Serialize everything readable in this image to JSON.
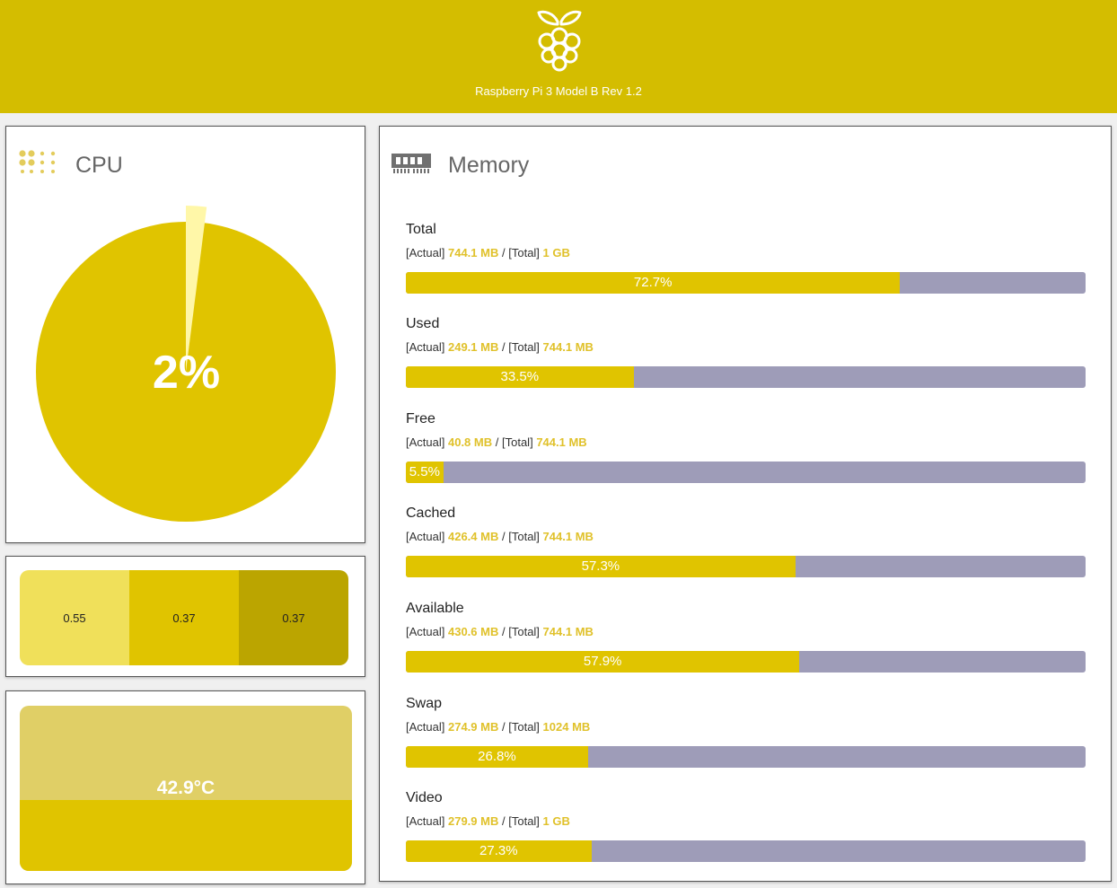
{
  "header": {
    "title": "Raspberry Pi 3 Model B Rev 1.2",
    "logo_icon": "raspberry-pi-logo-icon",
    "background": "#d4bd00"
  },
  "cpu": {
    "title": "CPU",
    "icon": "cpu-chip-icon",
    "usage_label": "2%",
    "usage_fraction": 0.02,
    "colors": {
      "used": "#fff7a8",
      "free": "#e0c400"
    }
  },
  "load": {
    "values": [
      "0.55",
      "0.37",
      "0.37"
    ],
    "colors": [
      "#f0e05a",
      "#e0c400",
      "#bba500"
    ]
  },
  "temperature": {
    "label": "42.9°C",
    "fill_fraction": 0.429,
    "colors": {
      "fill": "#e0c400",
      "empty": "#e0cf66"
    }
  },
  "memory": {
    "title": "Memory",
    "icon": "ram-module-icon",
    "items": [
      {
        "name": "Total",
        "actual_label": "[Actual]",
        "actual": "744.1 MB",
        "sep": "/",
        "total_label": "[Total]",
        "total": "1 GB",
        "percent": "72.7%",
        "fraction": 0.727
      },
      {
        "name": "Used",
        "actual_label": "[Actual]",
        "actual": "249.1 MB",
        "sep": "/",
        "total_label": "[Total]",
        "total": "744.1 MB",
        "percent": "33.5%",
        "fraction": 0.335
      },
      {
        "name": "Free",
        "actual_label": "[Actual]",
        "actual": "40.8 MB",
        "sep": "/",
        "total_label": "[Total]",
        "total": "744.1 MB",
        "percent": "5.5%",
        "fraction": 0.055
      },
      {
        "name": "Cached",
        "actual_label": "[Actual]",
        "actual": "426.4 MB",
        "sep": "/",
        "total_label": "[Total]",
        "total": "744.1 MB",
        "percent": "57.3%",
        "fraction": 0.573
      },
      {
        "name": "Available",
        "actual_label": "[Actual]",
        "actual": "430.6 MB",
        "sep": "/",
        "total_label": "[Total]",
        "total": "744.1 MB",
        "percent": "57.9%",
        "fraction": 0.579
      },
      {
        "name": "Swap",
        "actual_label": "[Actual]",
        "actual": "274.9 MB",
        "sep": "/",
        "total_label": "[Total]",
        "total": "1024 MB",
        "percent": "26.8%",
        "fraction": 0.268
      },
      {
        "name": "Video",
        "actual_label": "[Actual]",
        "actual": "279.9 MB",
        "sep": "/",
        "total_label": "[Total]",
        "total": "1 GB",
        "percent": "27.3%",
        "fraction": 0.273
      }
    ],
    "colors": {
      "fill": "#e0c400",
      "track": "#9e9cb8",
      "value": "#e0c12a"
    }
  }
}
